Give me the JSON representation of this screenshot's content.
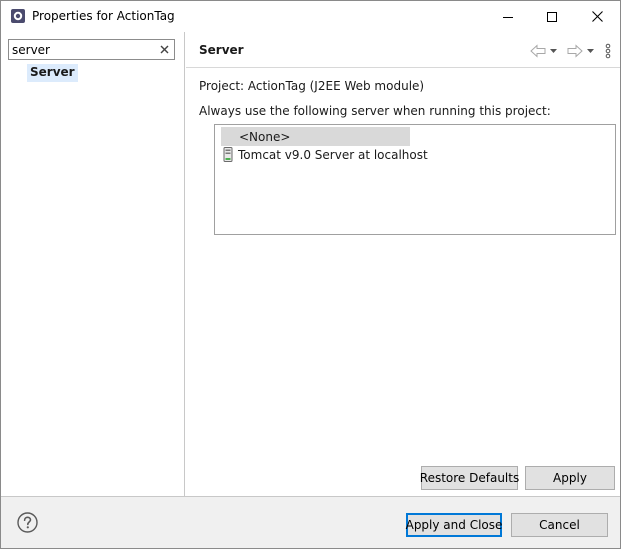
{
  "window": {
    "title": "Properties for ActionTag",
    "icon": "eclipse-gear-icon",
    "controls": [
      "minimize-icon",
      "maximize-icon",
      "close-icon"
    ]
  },
  "sidebar": {
    "filter": {
      "value": "server",
      "placeholder": ""
    },
    "items": [
      {
        "label": "Server",
        "selected": true
      }
    ]
  },
  "page": {
    "title": "Server",
    "nav_icons": [
      "back-arrow-icon",
      "chevron-down-icon",
      "forward-arrow-icon",
      "chevron-down-icon",
      "more-vertical-icon"
    ],
    "project_label": "Project: ActionTag (J2EE Web module)",
    "instruction": "Always use the following server when running this project:",
    "servers": [
      {
        "label": "<None>",
        "selected": true,
        "icon": ""
      },
      {
        "label": "Tomcat v9.0 Server at localhost",
        "selected": false,
        "icon": "server-icon"
      }
    ],
    "restore_defaults_label": "Restore Defaults",
    "apply_label": "Apply"
  },
  "footer": {
    "help_icon": "help-icon",
    "apply_close_label": "Apply and Close",
    "cancel_label": "Cancel"
  },
  "colors": {
    "selection_tree": "#dcebfc",
    "selection_list": "#d9d9d9",
    "default_button_border": "#0078d7",
    "footer_bg": "#f0f0f0"
  }
}
